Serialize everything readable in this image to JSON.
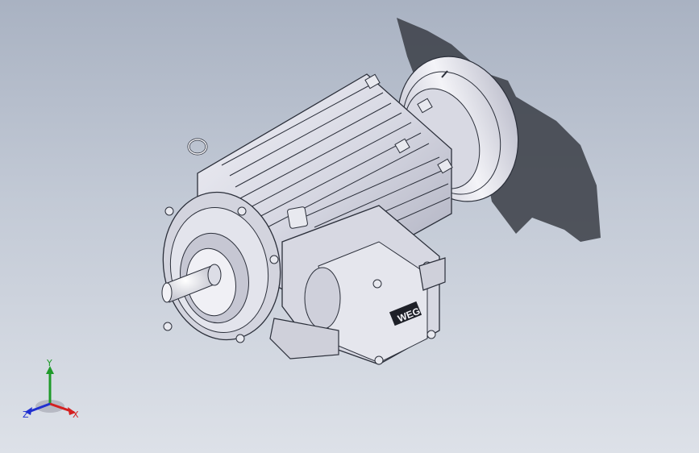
{
  "viewport": {
    "background_top": "#a9b2c2",
    "background_bottom": "#dde1e8"
  },
  "model": {
    "name_plate_text": "WEG",
    "line_color": "#2b2f3a",
    "body_color": "#dcdde6",
    "fan_cover_color": "#e6e7ee",
    "shadow_color": "#3a3d45"
  },
  "triad": {
    "x_label": "X",
    "y_label": "Y",
    "z_label": "Z",
    "x_color": "#d42020",
    "y_color": "#1f9a2a",
    "z_color": "#2030d0"
  }
}
